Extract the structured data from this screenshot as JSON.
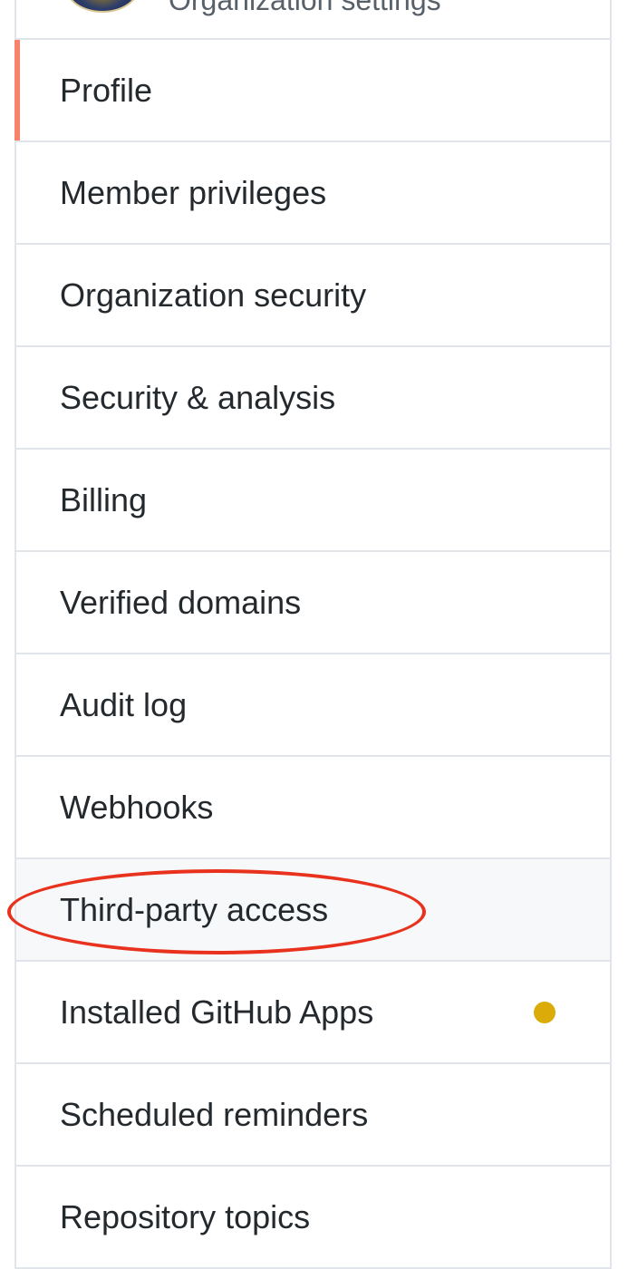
{
  "header": {
    "title": "Organization settings"
  },
  "menu": {
    "items": [
      {
        "label": "Profile",
        "selected": true
      },
      {
        "label": "Member privileges"
      },
      {
        "label": "Organization security"
      },
      {
        "label": "Security & analysis"
      },
      {
        "label": "Billing"
      },
      {
        "label": "Verified domains"
      },
      {
        "label": "Audit log"
      },
      {
        "label": "Webhooks"
      },
      {
        "label": "Third-party access",
        "hovered": true,
        "annotated": true
      },
      {
        "label": "Installed GitHub Apps",
        "indicator": "notification-dot"
      },
      {
        "label": "Scheduled reminders"
      },
      {
        "label": "Repository topics"
      }
    ]
  },
  "colors": {
    "selected_accent": "#f9826c",
    "indicator_dot": "#dbab09",
    "annotation_circle": "#e8321e",
    "hover_background": "#f6f8fa"
  }
}
